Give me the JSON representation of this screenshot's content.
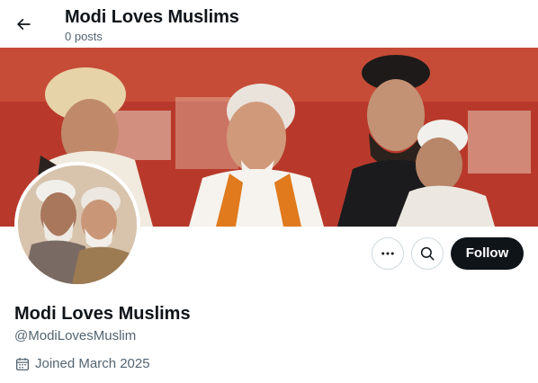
{
  "header": {
    "title": "Modi Loves Muslims",
    "post_count": "0 posts",
    "back_icon": "arrow-left-icon"
  },
  "banner": {
    "description_icon": "banner-photo"
  },
  "actions": {
    "more_icon": "more-horizontal-icon",
    "search_icon": "search-icon",
    "follow_label": "Follow"
  },
  "profile": {
    "display_name": "Modi Loves Muslims",
    "handle": "@ModiLovesMuslim",
    "joined_icon": "calendar-icon",
    "joined": "Joined March 2025"
  },
  "colors": {
    "text_primary": "#0f1419",
    "text_secondary": "#536471",
    "border": "#cfd9de",
    "follow_bg": "#0f1419",
    "follow_text": "#ffffff"
  }
}
